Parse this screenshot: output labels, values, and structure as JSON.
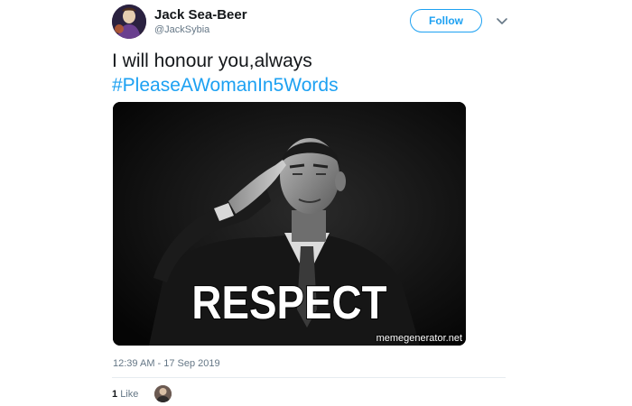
{
  "user": {
    "display_name": "Jack Sea-Beer",
    "handle": "@JackSybia"
  },
  "follow_label": "Follow",
  "tweet": {
    "text": "I will honour you,always",
    "hashtag": "#PleaseAWomanIn5Words"
  },
  "media": {
    "caption": "RESPECT",
    "watermark": "memegenerator.net"
  },
  "timestamp": "12:39 AM - 17 Sep 2019",
  "likes": {
    "count": "1",
    "label": "Like"
  },
  "colors": {
    "accent": "#1da1f2",
    "secondary_text": "#657786",
    "primary_text": "#14171a"
  },
  "icons": {
    "caret": "chevron-down-icon"
  }
}
